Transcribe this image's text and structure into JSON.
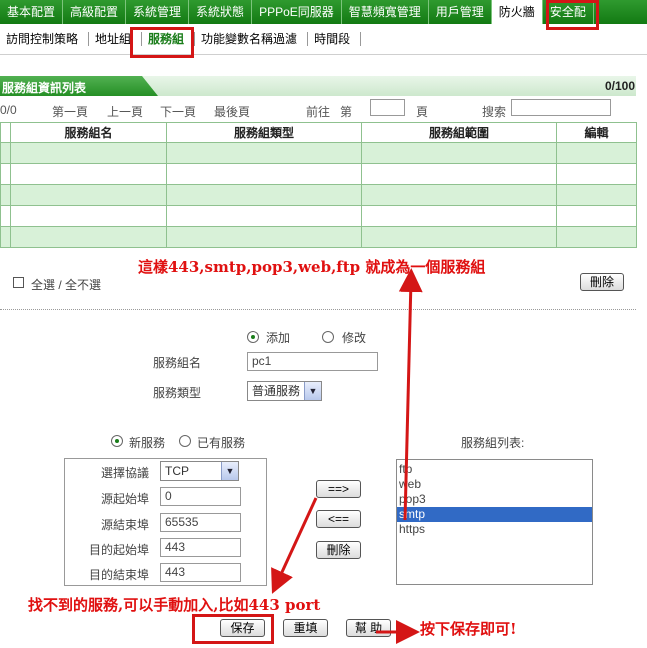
{
  "top_nav": [
    "基本配置",
    "高級配置",
    "系統管理",
    "系統狀態",
    "PPPoE同服器",
    "智慧頻寬管理",
    "用戶管理",
    "防火牆",
    "安全配"
  ],
  "top_nav_active": "防火牆",
  "sub_nav": [
    "訪問控制策略",
    "地址組",
    "服務組",
    "功能變數名稱過濾",
    "時間段"
  ],
  "sub_nav_active": "服務組",
  "list": {
    "title": "服務組資訊列表",
    "count": "0/100",
    "pager": {
      "total": "0/0",
      "first": "第一頁",
      "prev": "上一頁",
      "next": "下一頁",
      "last": "最後頁",
      "goto_prefix": "前往",
      "goto_label": "第",
      "page_label": "頁",
      "search_label": "搜索",
      "goto_value": "",
      "search_value": ""
    },
    "columns": [
      "服務組名",
      "服務組類型",
      "服務組範圍",
      "編輯"
    ],
    "empty_rows": 5
  },
  "select_all_label": "全選 / 全不選",
  "delete_label": "刪除",
  "form": {
    "mode_add": "添加",
    "mode_edit": "修改",
    "mode_selected": "添加",
    "name_label": "服務組名",
    "name_value": "pc1",
    "type_label": "服務類型",
    "type_value": "普通服務",
    "new_service": "新服務",
    "existing_service": "已有服務",
    "service_selected": "新服務",
    "protocol_label": "選擇協議",
    "protocol_value": "TCP",
    "src_start_label": "源起始埠",
    "src_start_value": "0",
    "src_end_label": "源結束埠",
    "src_end_value": "65535",
    "dst_start_label": "目的起始埠",
    "dst_start_value": "443",
    "dst_end_label": "目的結束埠",
    "dst_end_value": "443",
    "add_arrow": "==>",
    "remove_arrow": "<==",
    "remove_label": "刪除",
    "group_list_label": "服務組列表:",
    "group_list": [
      "ftp",
      "web",
      "pop3",
      "smtp",
      "https"
    ],
    "group_list_selected": "smtp",
    "save": "保存",
    "reset": "重填",
    "help": "幫 助"
  },
  "annotations": {
    "group_note": "這樣443,smtp,pop3,web,ftp  就成為一個服務組",
    "manual_note": "找不到的服務,可以手動加入,比如443  port",
    "save_note": "按下保存即可!"
  },
  "colors": {
    "nav_green": "#1a8a1a",
    "row_green": "#d8f1d8",
    "annotation_red": "#e01010",
    "selection_blue": "#316ac5"
  }
}
